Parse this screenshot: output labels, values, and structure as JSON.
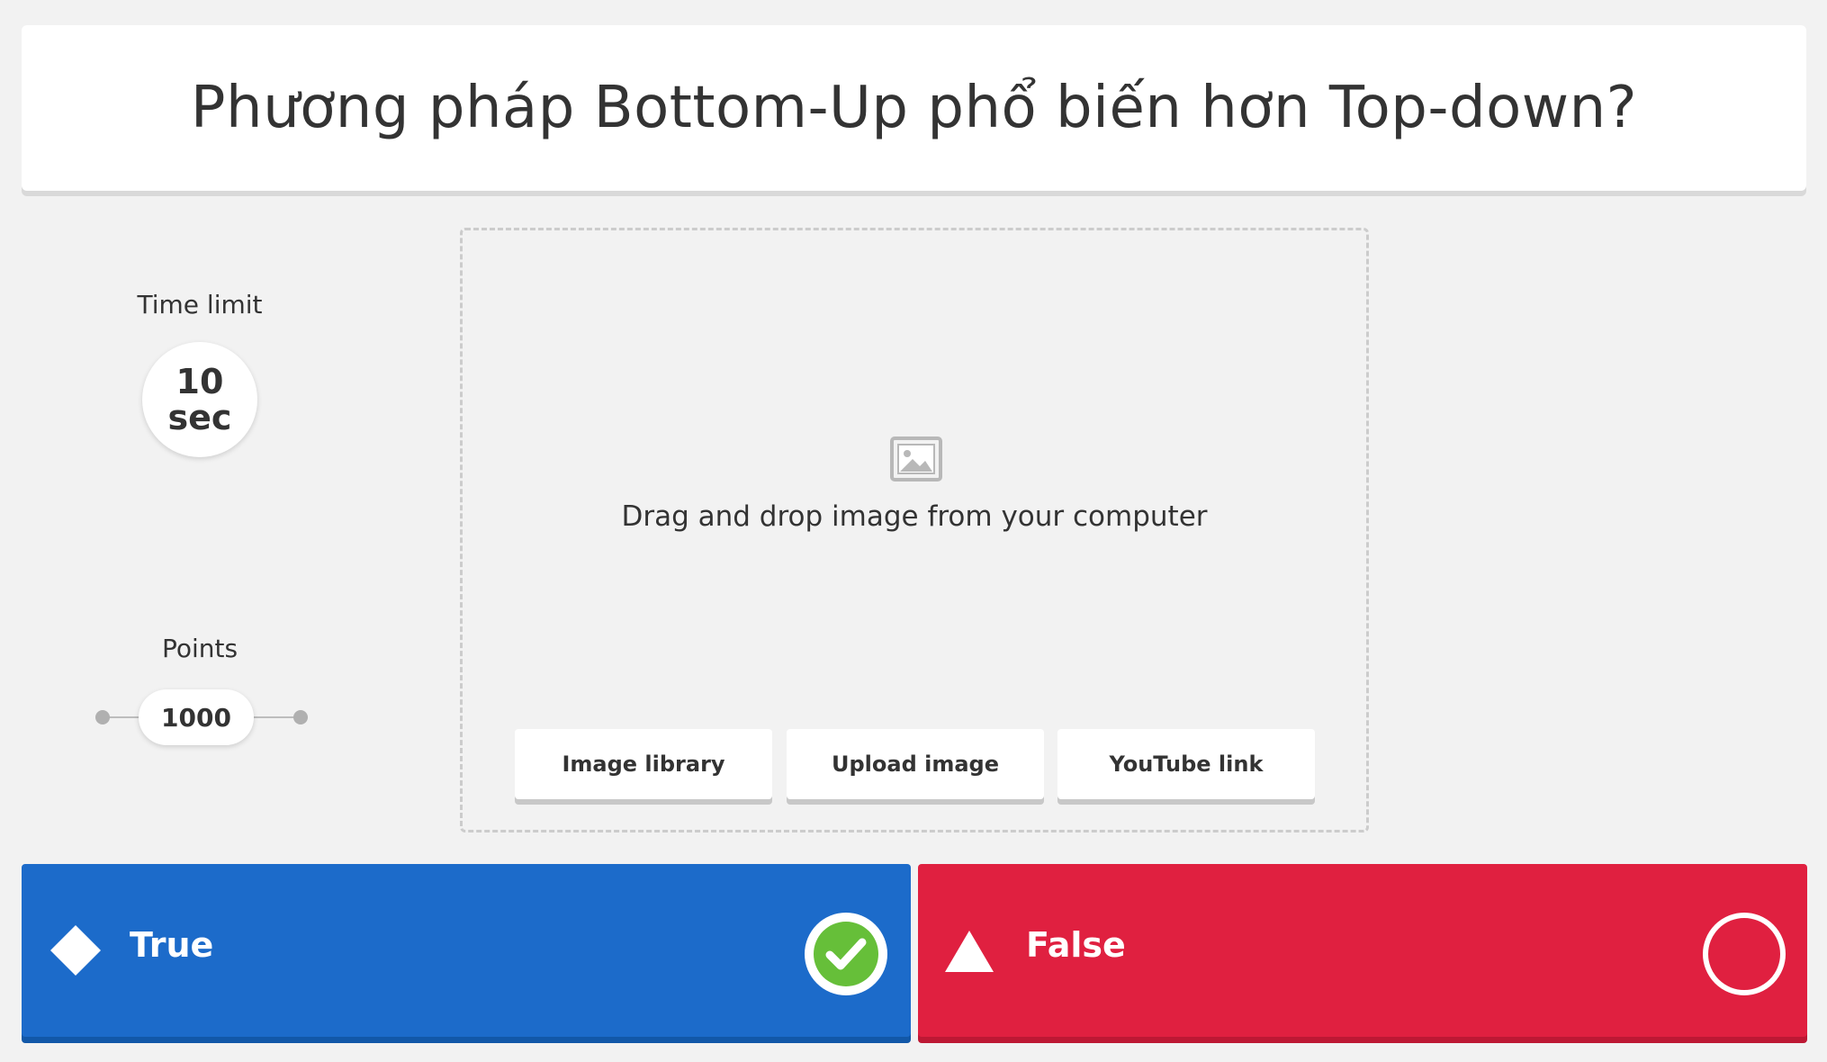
{
  "question": {
    "title": "Phương pháp Bottom-Up phổ biến hơn Top-down?"
  },
  "settings": {
    "time_limit_label": "Time limit",
    "time_value": "10",
    "time_unit": "sec",
    "points_label": "Points",
    "points_value": "1000"
  },
  "media": {
    "icon": "image-placeholder-icon",
    "drop_text": "Drag and drop image from your computer",
    "buttons": {
      "library": "Image library",
      "upload": "Upload image",
      "youtube": "YouTube link"
    }
  },
  "answers": [
    {
      "label": "True",
      "shape": "diamond-icon",
      "color": "#1c6bca",
      "correct": true
    },
    {
      "label": "False",
      "shape": "triangle-icon",
      "color": "#e02040",
      "correct": false
    }
  ],
  "colors": {
    "background": "#f2f2f2",
    "correct_check": "#66bf39"
  }
}
